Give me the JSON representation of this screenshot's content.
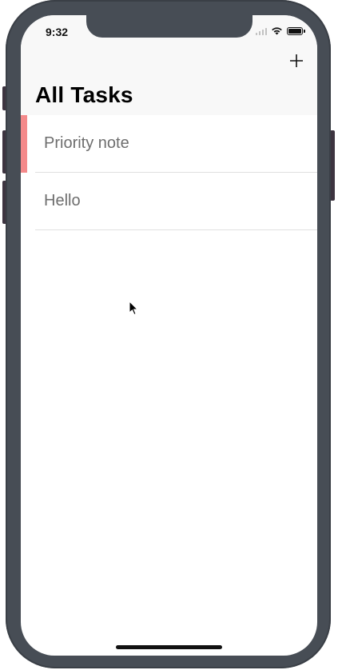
{
  "status_bar": {
    "time": "9:32"
  },
  "nav": {
    "title": "All Tasks",
    "add_button_icon": "plus-icon"
  },
  "tasks": [
    {
      "label": "Priority note",
      "priority": true,
      "priority_color": "#f4898a"
    },
    {
      "label": "Hello",
      "priority": false
    }
  ],
  "colors": {
    "device_frame": "#474d55",
    "nav_background": "#f8f8f8",
    "task_text": "#6e6e6e",
    "priority_accent": "#f4898a"
  }
}
